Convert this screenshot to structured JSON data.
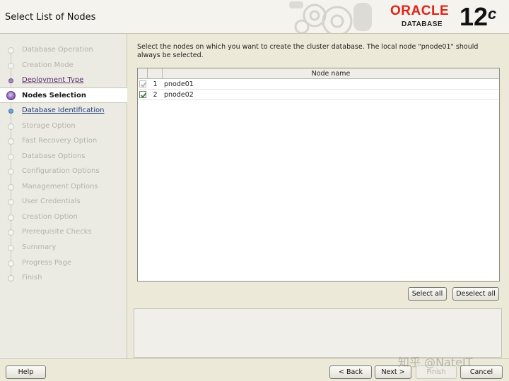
{
  "header": {
    "title": "Select List of Nodes",
    "logo_brand": "ORACLE",
    "logo_product": "DATABASE",
    "version_main": "12",
    "version_suffix": "c"
  },
  "sidebar": {
    "steps": [
      {
        "label": "Database Operation",
        "state": "done"
      },
      {
        "label": "Creation Mode",
        "state": "done"
      },
      {
        "label": "Deployment Type",
        "state": "visited"
      },
      {
        "label": "Nodes Selection",
        "state": "current"
      },
      {
        "label": "Database Identification",
        "state": "link"
      },
      {
        "label": "Storage Option",
        "state": "disabled"
      },
      {
        "label": "Fast Recovery Option",
        "state": "disabled"
      },
      {
        "label": "Database Options",
        "state": "disabled"
      },
      {
        "label": "Configuration Options",
        "state": "disabled"
      },
      {
        "label": "Management Options",
        "state": "disabled"
      },
      {
        "label": "User Credentials",
        "state": "disabled"
      },
      {
        "label": "Creation Option",
        "state": "disabled"
      },
      {
        "label": "Prerequisite Checks",
        "state": "disabled"
      },
      {
        "label": "Summary",
        "state": "disabled"
      },
      {
        "label": "Progress Page",
        "state": "disabled"
      },
      {
        "label": "Finish",
        "state": "disabled"
      }
    ]
  },
  "main": {
    "instruction": "Select the nodes on which you want to create the cluster database. The local node \"pnode01\" should always be selected.",
    "table": {
      "column_header": "Node name",
      "rows": [
        {
          "index": "1",
          "name": "pnode01",
          "checked": true,
          "disabled": true
        },
        {
          "index": "2",
          "name": "pnode02",
          "checked": true,
          "disabled": false
        }
      ]
    },
    "select_all_label": "Select all",
    "deselect_all_label": "Deselect all"
  },
  "footer": {
    "help_label": "Help",
    "back_label": "< Back",
    "next_label": "Next >",
    "finish_label": "Finish",
    "cancel_label": "Cancel"
  },
  "watermark": "知乎 @NateIT",
  "colors": {
    "oracle_red": "#e2231a",
    "current_step": "#8a63b5",
    "link_step": "#6fa5d9",
    "check_green": "#2e8b1f"
  }
}
